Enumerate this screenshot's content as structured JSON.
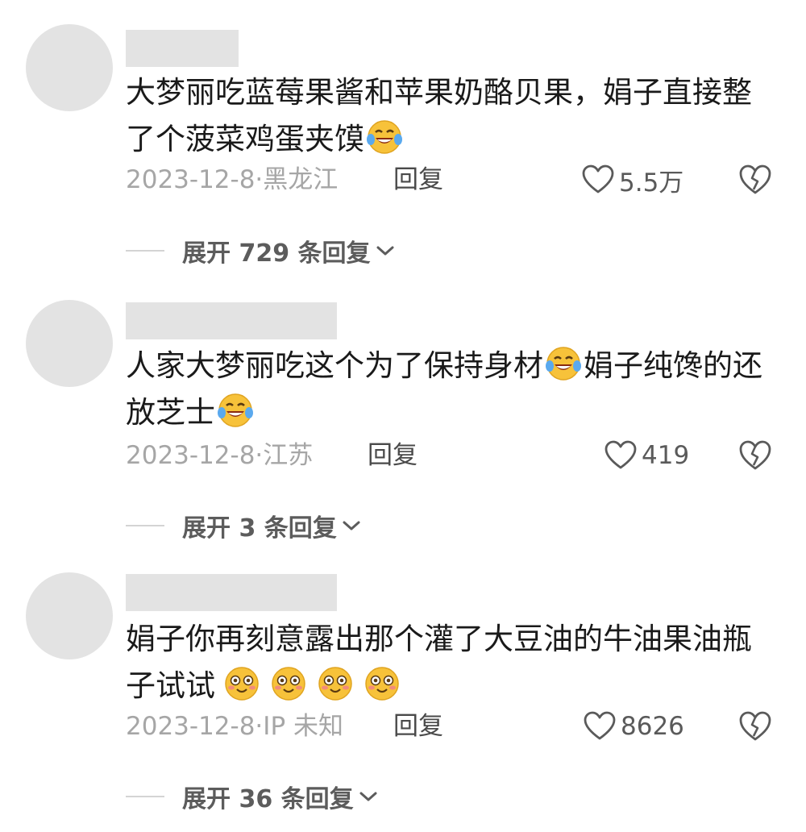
{
  "comments": [
    {
      "text": "大梦丽吃蓝莓果酱和苹果奶酪贝果，娟子直接整了个菠菜鸡蛋夹馍",
      "emoji": [
        "face-with-tears-of-joy"
      ],
      "date": "2023-12-8·",
      "location": "黑龙江",
      "reply_label": "回复",
      "likes": "5.5万",
      "expand_label": "展开 729 条回复"
    },
    {
      "text": "人家大梦丽吃这个为了保持身材",
      "text_after_emoji": "娟子纯馋的还放芝士",
      "emoji": [
        "face-with-tears-of-joy",
        "face-with-tears-of-joy"
      ],
      "date": "2023-12-8·",
      "location": "江苏",
      "reply_label": "回复",
      "likes": "419",
      "expand_label": "展开 3 条回复"
    },
    {
      "text": "娟子你再刻意露出那个灌了大豆油的牛油果油瓶子试试",
      "emoji": [
        "flushed-smile-face",
        "flushed-smile-face",
        "flushed-smile-face",
        "flushed-smile-face"
      ],
      "date": "2023-12-8·",
      "location": "IP 未知",
      "reply_label": "回复",
      "likes": "8626",
      "expand_label": "展开 36 条回复"
    }
  ],
  "colors": {
    "placeholder_gray": "#e3e3e3",
    "body_text": "#1a1a1a",
    "meta_text": "#a6a6a6",
    "emoji_yellow": "#f7c23a"
  }
}
